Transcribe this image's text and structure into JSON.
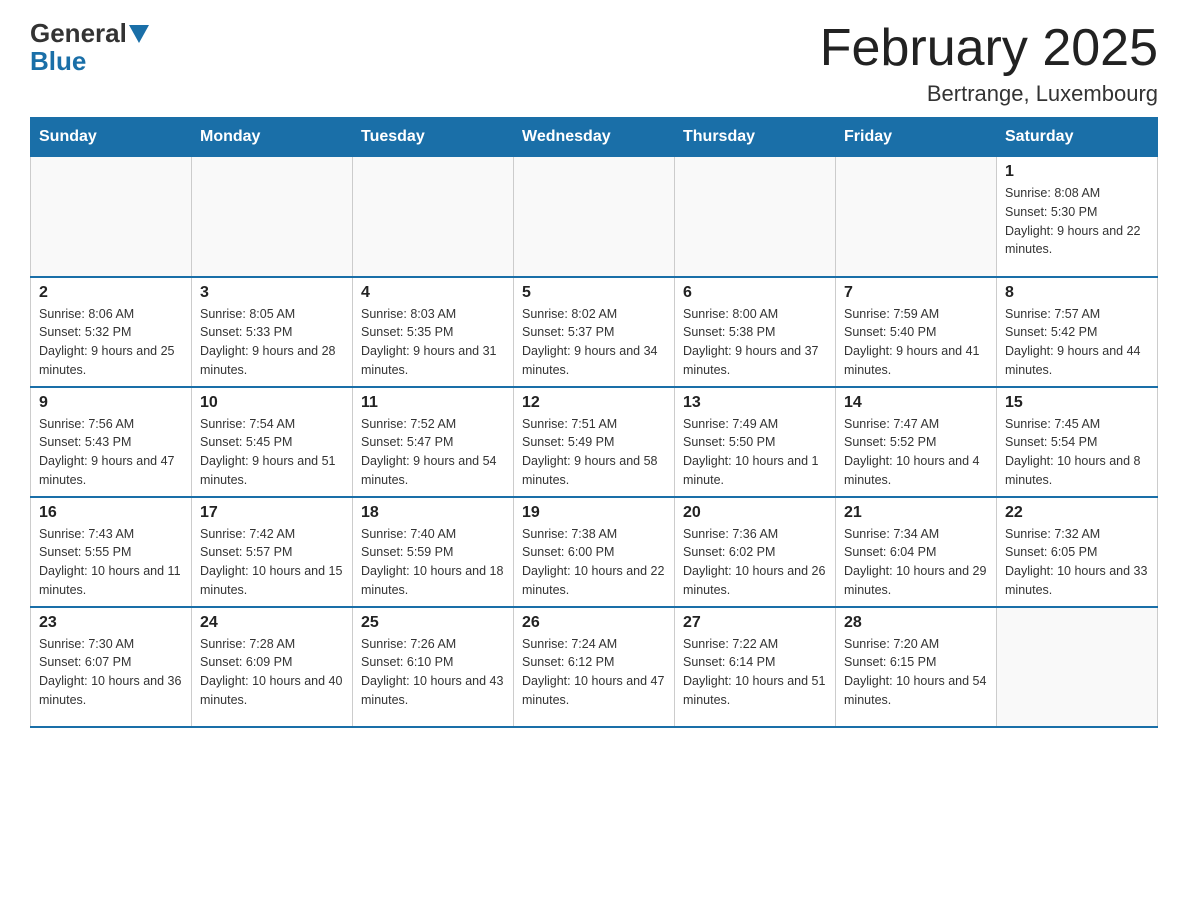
{
  "logo": {
    "general": "General",
    "blue": "Blue"
  },
  "title": {
    "month": "February 2025",
    "location": "Bertrange, Luxembourg"
  },
  "weekdays": [
    "Sunday",
    "Monday",
    "Tuesday",
    "Wednesday",
    "Thursday",
    "Friday",
    "Saturday"
  ],
  "weeks": [
    [
      {
        "day": "",
        "info": ""
      },
      {
        "day": "",
        "info": ""
      },
      {
        "day": "",
        "info": ""
      },
      {
        "day": "",
        "info": ""
      },
      {
        "day": "",
        "info": ""
      },
      {
        "day": "",
        "info": ""
      },
      {
        "day": "1",
        "info": "Sunrise: 8:08 AM\nSunset: 5:30 PM\nDaylight: 9 hours and 22 minutes."
      }
    ],
    [
      {
        "day": "2",
        "info": "Sunrise: 8:06 AM\nSunset: 5:32 PM\nDaylight: 9 hours and 25 minutes."
      },
      {
        "day": "3",
        "info": "Sunrise: 8:05 AM\nSunset: 5:33 PM\nDaylight: 9 hours and 28 minutes."
      },
      {
        "day": "4",
        "info": "Sunrise: 8:03 AM\nSunset: 5:35 PM\nDaylight: 9 hours and 31 minutes."
      },
      {
        "day": "5",
        "info": "Sunrise: 8:02 AM\nSunset: 5:37 PM\nDaylight: 9 hours and 34 minutes."
      },
      {
        "day": "6",
        "info": "Sunrise: 8:00 AM\nSunset: 5:38 PM\nDaylight: 9 hours and 37 minutes."
      },
      {
        "day": "7",
        "info": "Sunrise: 7:59 AM\nSunset: 5:40 PM\nDaylight: 9 hours and 41 minutes."
      },
      {
        "day": "8",
        "info": "Sunrise: 7:57 AM\nSunset: 5:42 PM\nDaylight: 9 hours and 44 minutes."
      }
    ],
    [
      {
        "day": "9",
        "info": "Sunrise: 7:56 AM\nSunset: 5:43 PM\nDaylight: 9 hours and 47 minutes."
      },
      {
        "day": "10",
        "info": "Sunrise: 7:54 AM\nSunset: 5:45 PM\nDaylight: 9 hours and 51 minutes."
      },
      {
        "day": "11",
        "info": "Sunrise: 7:52 AM\nSunset: 5:47 PM\nDaylight: 9 hours and 54 minutes."
      },
      {
        "day": "12",
        "info": "Sunrise: 7:51 AM\nSunset: 5:49 PM\nDaylight: 9 hours and 58 minutes."
      },
      {
        "day": "13",
        "info": "Sunrise: 7:49 AM\nSunset: 5:50 PM\nDaylight: 10 hours and 1 minute."
      },
      {
        "day": "14",
        "info": "Sunrise: 7:47 AM\nSunset: 5:52 PM\nDaylight: 10 hours and 4 minutes."
      },
      {
        "day": "15",
        "info": "Sunrise: 7:45 AM\nSunset: 5:54 PM\nDaylight: 10 hours and 8 minutes."
      }
    ],
    [
      {
        "day": "16",
        "info": "Sunrise: 7:43 AM\nSunset: 5:55 PM\nDaylight: 10 hours and 11 minutes."
      },
      {
        "day": "17",
        "info": "Sunrise: 7:42 AM\nSunset: 5:57 PM\nDaylight: 10 hours and 15 minutes."
      },
      {
        "day": "18",
        "info": "Sunrise: 7:40 AM\nSunset: 5:59 PM\nDaylight: 10 hours and 18 minutes."
      },
      {
        "day": "19",
        "info": "Sunrise: 7:38 AM\nSunset: 6:00 PM\nDaylight: 10 hours and 22 minutes."
      },
      {
        "day": "20",
        "info": "Sunrise: 7:36 AM\nSunset: 6:02 PM\nDaylight: 10 hours and 26 minutes."
      },
      {
        "day": "21",
        "info": "Sunrise: 7:34 AM\nSunset: 6:04 PM\nDaylight: 10 hours and 29 minutes."
      },
      {
        "day": "22",
        "info": "Sunrise: 7:32 AM\nSunset: 6:05 PM\nDaylight: 10 hours and 33 minutes."
      }
    ],
    [
      {
        "day": "23",
        "info": "Sunrise: 7:30 AM\nSunset: 6:07 PM\nDaylight: 10 hours and 36 minutes."
      },
      {
        "day": "24",
        "info": "Sunrise: 7:28 AM\nSunset: 6:09 PM\nDaylight: 10 hours and 40 minutes."
      },
      {
        "day": "25",
        "info": "Sunrise: 7:26 AM\nSunset: 6:10 PM\nDaylight: 10 hours and 43 minutes."
      },
      {
        "day": "26",
        "info": "Sunrise: 7:24 AM\nSunset: 6:12 PM\nDaylight: 10 hours and 47 minutes."
      },
      {
        "day": "27",
        "info": "Sunrise: 7:22 AM\nSunset: 6:14 PM\nDaylight: 10 hours and 51 minutes."
      },
      {
        "day": "28",
        "info": "Sunrise: 7:20 AM\nSunset: 6:15 PM\nDaylight: 10 hours and 54 minutes."
      },
      {
        "day": "",
        "info": ""
      }
    ]
  ]
}
